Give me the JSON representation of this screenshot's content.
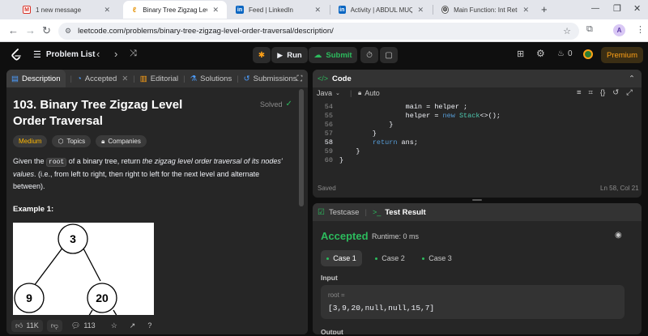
{
  "browser": {
    "tabs": [
      {
        "title": "1 new message",
        "active": false
      },
      {
        "title": "Binary Tree Zigzag Level O",
        "active": true
      },
      {
        "title": "Feed | LinkedIn",
        "active": false
      },
      {
        "title": "Activity | ABDUL MUQEE",
        "active": false
      },
      {
        "title": "Main Function: Int Return",
        "active": false
      }
    ],
    "new_tab": "+",
    "url": "leetcode.com/problems/binary-tree-zigzag-level-order-traversal/description/",
    "avatar_letter": "A"
  },
  "nav": {
    "problem_list": "Problem List",
    "run": "Run",
    "submit": "Submit",
    "streak": "0",
    "premium": "Premium"
  },
  "left": {
    "tabs": [
      "Description",
      "Accepted",
      "Editorial",
      "Solutions",
      "Submissions"
    ],
    "title": "103. Binary Tree Zigzag Level Order Traversal",
    "solved": "Solved",
    "tags": [
      "Medium",
      "Topics",
      "Companies"
    ],
    "desc_p1": "Given the ",
    "desc_code": "root",
    "desc_p2": " of a binary tree, return ",
    "desc_em": "the zigzag level order traversal of its nodes' values",
    "desc_p3": ". (i.e., from left to right, then right to left for the next level and alternate between).",
    "example_title": "Example 1:",
    "tree_nodes": [
      "3",
      "9",
      "20"
    ],
    "footer": {
      "likes": "11K",
      "comments": "113"
    }
  },
  "code": {
    "tab": "Code",
    "language": "Java",
    "mode": "Auto",
    "lines": [
      {
        "no": "54",
        "text": "                main = helper ;",
        "active": false
      },
      {
        "no": "55",
        "text": "                helper = new Stack<>();",
        "active": false
      },
      {
        "no": "56",
        "text": "            }",
        "active": false
      },
      {
        "no": "57",
        "text": "        }",
        "active": false
      },
      {
        "no": "58",
        "text": "        return ans;",
        "active": true
      },
      {
        "no": "59",
        "text": "    }",
        "active": false
      },
      {
        "no": "60",
        "text": "}",
        "active": false
      }
    ],
    "saved": "Saved",
    "cursor": "Ln 58, Col 21"
  },
  "result": {
    "tabs": [
      "Testcase",
      "Test Result"
    ],
    "status": "Accepted",
    "runtime": "Runtime: 0 ms",
    "cases": [
      "Case 1",
      "Case 2",
      "Case 3"
    ],
    "input_label": "Input",
    "var_name": "root =",
    "var_value": "[3,9,20,null,null,15,7]",
    "output_label": "Output"
  },
  "colors": {
    "accent": "#ffa116",
    "green": "#2cbb5d",
    "blue": "#007aff",
    "medium": "#ffb800"
  }
}
